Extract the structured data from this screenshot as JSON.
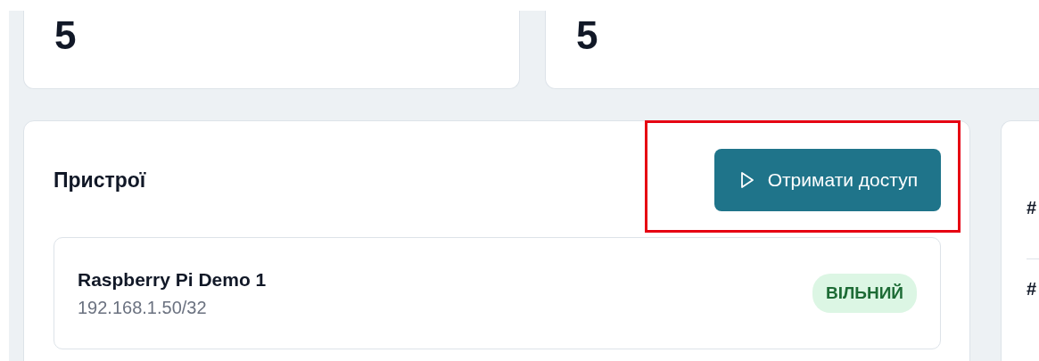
{
  "stats": [
    {
      "value": "5"
    },
    {
      "value": "5"
    }
  ],
  "devices_panel": {
    "title": "Пристрої",
    "action_button": {
      "label": "Отримати доступ",
      "highlighted": true
    },
    "devices": [
      {
        "name": "Raspberry Pi Demo 1",
        "address": "192.168.1.50/32",
        "status": {
          "label": "ВІЛЬНИЙ",
          "kind": "free"
        }
      }
    ]
  },
  "side_panel": {
    "items": [
      {
        "title": "#"
      },
      {
        "title": "#"
      }
    ]
  }
}
